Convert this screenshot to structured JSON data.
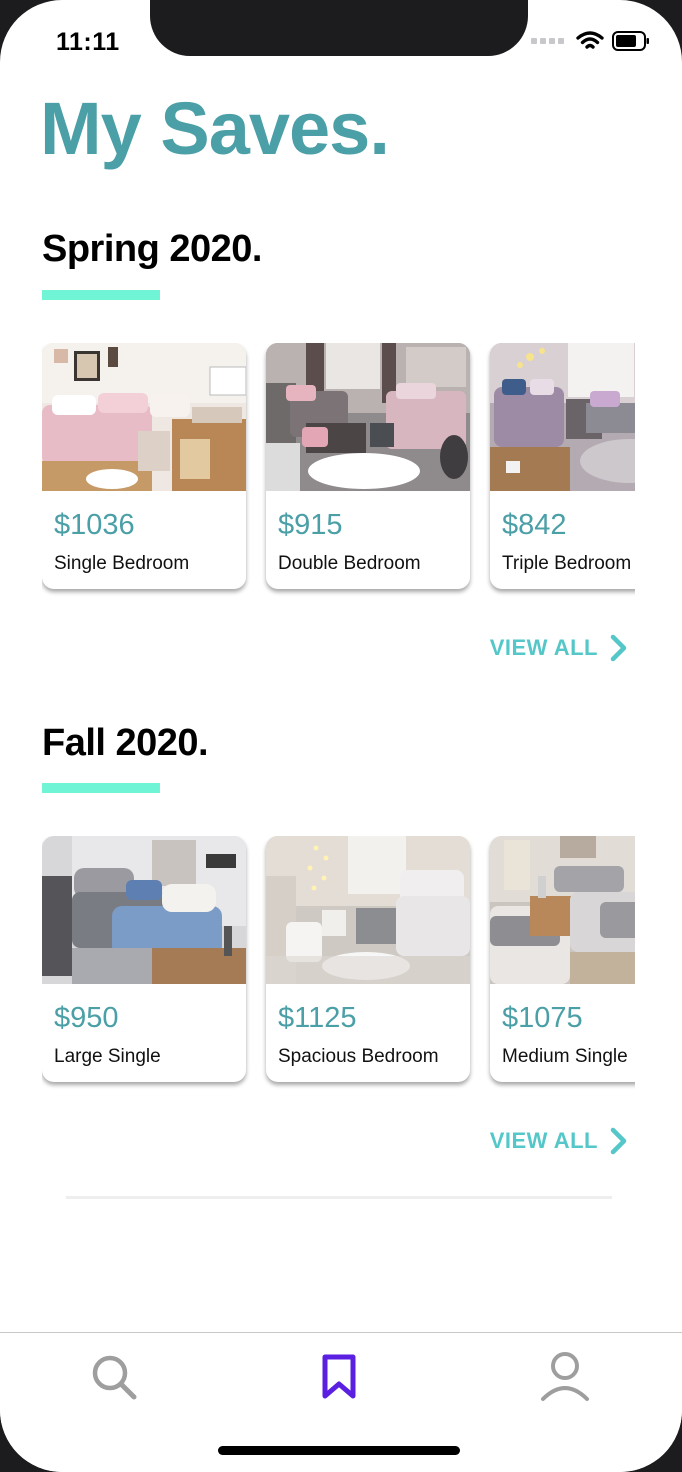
{
  "status_bar": {
    "time": "11:11"
  },
  "page": {
    "title": "My Saves."
  },
  "colors": {
    "accent_teal": "#4b9fa6",
    "underline_mint": "#6ff5d6",
    "view_all": "#55c7c8",
    "active_tab": "#5a1fe0",
    "inactive_tab": "#9e9e9e"
  },
  "sections": [
    {
      "title": "Spring 2020.",
      "view_all_label": "VIEW ALL",
      "cards": [
        {
          "price": "$1036",
          "name": "Single Bedroom",
          "image": "pink-dorm-room-photo"
        },
        {
          "price": "$915",
          "name": "Double Bedroom",
          "image": "grey-pink-dorm-room-photo"
        },
        {
          "price": "$842",
          "name": "Triple Bedroom",
          "image": "lavender-dorm-room-photo"
        }
      ]
    },
    {
      "title": "Fall 2020.",
      "view_all_label": "VIEW ALL",
      "cards": [
        {
          "price": "$950",
          "name": "Large Single",
          "image": "blue-grey-dorm-room-photo"
        },
        {
          "price": "$1125",
          "name": "Spacious Bedroom",
          "image": "white-grey-dorm-room-photo"
        },
        {
          "price": "$1075",
          "name": "Medium Single",
          "image": "neutral-dorm-room-photo"
        }
      ]
    }
  ],
  "tab_bar": {
    "tabs": [
      {
        "icon": "search-icon",
        "active": false
      },
      {
        "icon": "bookmark-icon",
        "active": true
      },
      {
        "icon": "profile-icon",
        "active": false
      }
    ]
  }
}
